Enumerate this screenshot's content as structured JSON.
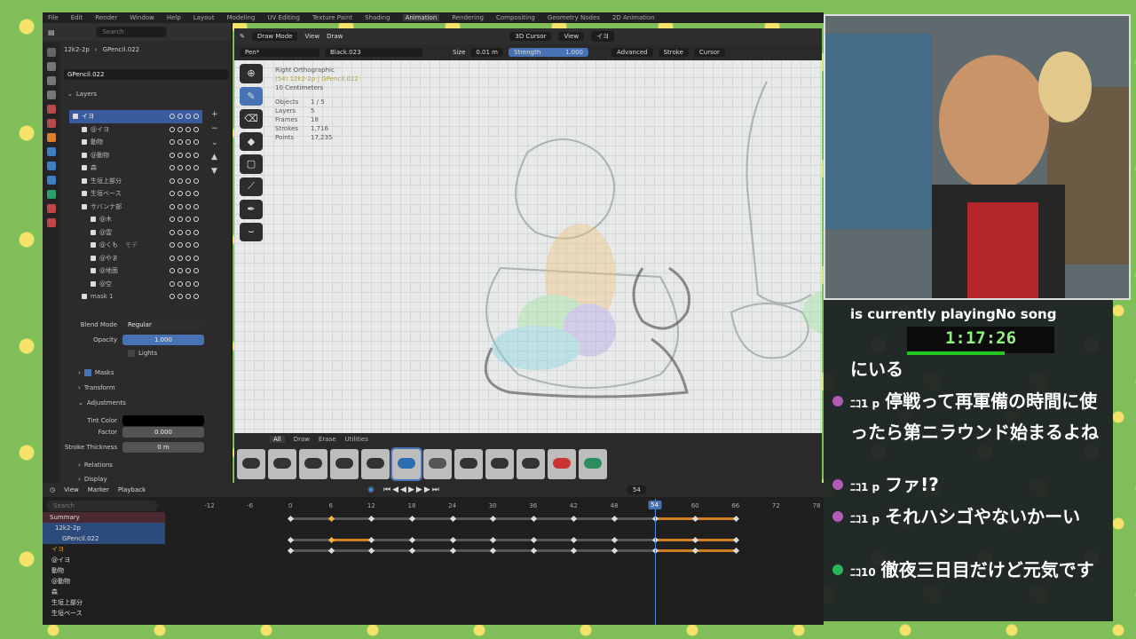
{
  "top_menu": {
    "items": [
      "File",
      "Edit",
      "Render",
      "Window",
      "Help",
      "Layout",
      "Modeling",
      "UV Editing",
      "Texture Paint",
      "Shading",
      "Animation",
      "Rendering",
      "Compositing",
      "Geometry Nodes",
      "2D Animation"
    ],
    "active_index": 10
  },
  "properties": {
    "search_placeholder": "Search",
    "breadcrumb_object": "12k2-2p",
    "breadcrumb_data": "GPencil.022",
    "datablock": "GPencil.022",
    "layers_title": "Layers",
    "layers": [
      "イヨ",
      "@イヨ",
      "動物",
      "@動物",
      "森",
      "生垣上部分",
      "生垣ベース",
      "サバンナ部",
      "@木",
      "@雲",
      "@くも",
      "@やま",
      "@地面",
      "@空",
      "mask 1"
    ],
    "layer_extra": "モデ",
    "selected_layer_index": 0,
    "blend_mode_label": "Blend Mode",
    "blend_mode_value": "Regular",
    "opacity_label": "Opacity",
    "opacity_value": "1.000",
    "lights_label": "Lights",
    "masks_label": "Masks",
    "transform_label": "Transform",
    "adjustments_label": "Adjustments",
    "tint_color_label": "Tint Color",
    "factor_label": "Factor",
    "factor_value": "0.000",
    "stroke_thickness_label": "Stroke Thickness",
    "stroke_thickness_value": "0 m",
    "relations_label": "Relations",
    "display_label": "Display"
  },
  "viewport": {
    "mode": "Draw Mode",
    "view_menu": "View",
    "draw_menu": "Draw",
    "cursor_menu": "3D Cursor",
    "view_dropdown": "View",
    "layer_dropdown": "イヨ",
    "brush": "Pen*",
    "material": "Black.023",
    "size_label": "Size",
    "size_value": "0.01 m",
    "strength_label": "Strength",
    "strength_value": "1.000",
    "advanced": "Advanced",
    "stroke": "Stroke",
    "cursor": "Cursor",
    "info_view": "Right Orthographic",
    "info_object": "(54) 12k2-2p | GPencil.022",
    "info_scale": "10 Centimeters",
    "stats_labels": [
      "Objects",
      "Layers",
      "Frames",
      "Strokes",
      "Points"
    ],
    "stats_values": [
      "1 / 5",
      "5",
      "18",
      "1,716",
      "17,235"
    ]
  },
  "brush_panel": {
    "tabs": [
      "All",
      "Draw",
      "Erase",
      "Utilities"
    ],
    "active_tab": 0,
    "brush_colors": [
      "#333",
      "#333",
      "#333",
      "#333",
      "#333",
      "#2b6db0",
      "#555",
      "#333",
      "#333",
      "#333",
      "#c33",
      "#2a8c5f"
    ]
  },
  "timeline": {
    "view": "View",
    "marker": "Marker",
    "playback": "Playback",
    "current_frame_field": "54",
    "search_placeholder": "Search",
    "ticks": [
      "-12",
      "-6",
      "0",
      "6",
      "12",
      "18",
      "24",
      "30",
      "36",
      "42",
      "48",
      "54",
      "60",
      "66",
      "72",
      "78"
    ],
    "current_frame": "54",
    "rows": [
      "Summary",
      "12k2-2p",
      "GPencil.022",
      "イヨ",
      "@イヨ",
      "動物",
      "@動物",
      "森",
      "生垣上部分",
      "生垣ベース"
    ]
  },
  "stream": {
    "now_playing": "is currently playingNo song",
    "timer": "1:17:26",
    "chat": [
      {
        "user": "",
        "text": "にいる"
      },
      {
        "user": "ﾆｺ1 p",
        "text": "停戦って再軍備の時間に使ったら第ニラウンド始まるよね"
      },
      {
        "user": "ﾆｺ1 p",
        "text": "ファ!?"
      },
      {
        "user": "ﾆｺ1 p",
        "text": "それハシゴやないかーい"
      },
      {
        "user": "ﾆｺ10",
        "text": "徹夜三日目だけど元気です"
      }
    ]
  },
  "colors": {
    "accent": "#4772b3",
    "keyframe_bar": "#d07f21",
    "timer_green": "#23c61d"
  }
}
